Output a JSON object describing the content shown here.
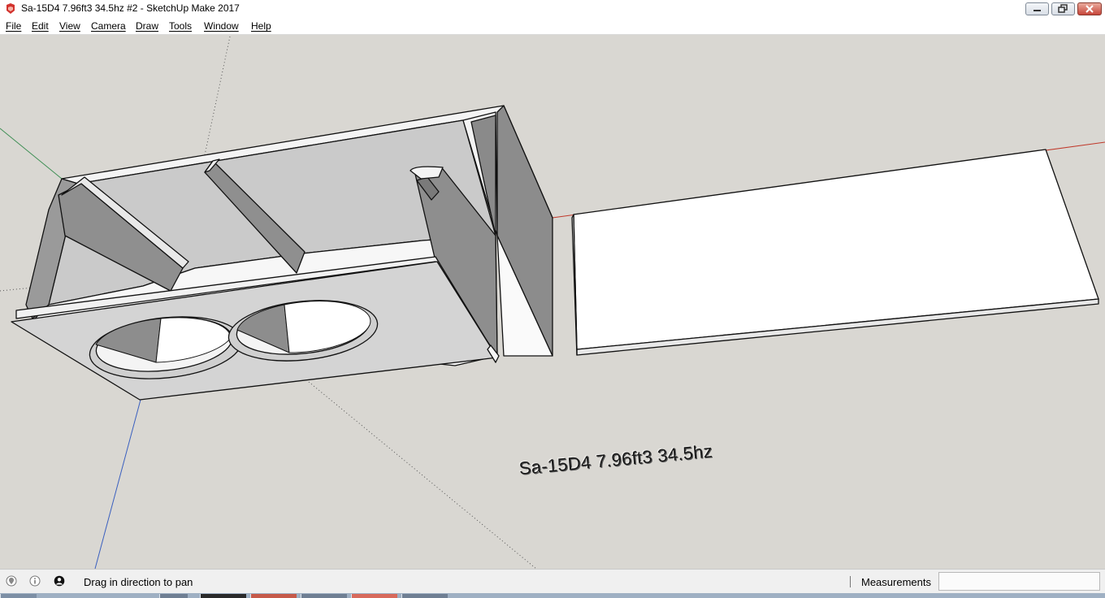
{
  "window": {
    "title": "Sa-15D4 7.96ft3 34.5hz #2 - SketchUp Make 2017",
    "app_icon": "sketchup-icon",
    "controls": [
      "minimize-icon",
      "restore-icon",
      "close-icon"
    ]
  },
  "menu": {
    "items": [
      "File",
      "Edit",
      "View",
      "Camera",
      "Draw",
      "Tools",
      "Window",
      "Help"
    ]
  },
  "viewport": {
    "model_label": "Sa-15D4 7.96ft3 34.5hz",
    "axis_colors": {
      "red": "#c0392b",
      "green": "#3f8f55",
      "blue": "#3a5fbf"
    }
  },
  "status": {
    "icons": [
      "geolocation-icon",
      "info-icon",
      "user-icon"
    ],
    "message": "Drag in direction to pan",
    "measurements_label": "Measurements",
    "measurements_value": ""
  }
}
